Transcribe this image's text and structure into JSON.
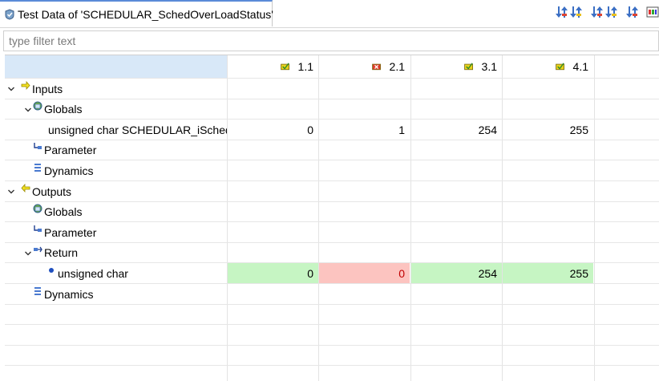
{
  "tab": {
    "title": "Test Data of 'SCHEDULAR_SchedOverLoadStatus'",
    "icon": "test-data-icon"
  },
  "toolbar": {
    "buttons": [
      {
        "icon": "move-down-up-icon"
      },
      {
        "icon": "move-down-up-icon"
      },
      {
        "icon": "move-down-up-icon"
      },
      {
        "icon": "move-down-up-icon"
      },
      {
        "icon": "move-down-up-icon"
      },
      {
        "icon": "view-menu-icon"
      }
    ]
  },
  "filter": {
    "placeholder": "type filter text",
    "value": ""
  },
  "columns": [
    {
      "label": "1.1",
      "status": "pass",
      "color": "#e8d21a"
    },
    {
      "label": "2.1",
      "status": "fail",
      "color": "#e03a2a"
    },
    {
      "label": "3.1",
      "status": "pass",
      "color": "#e8d21a"
    },
    {
      "label": "4.1",
      "status": "pass",
      "color": "#e8d21a"
    }
  ],
  "colors": {
    "pass_bg": "#c6f5c3",
    "fail_bg": "#fcc4c0",
    "fail_text": "#c00000",
    "header_bg": "#d8e8f8"
  },
  "rows": [
    {
      "label": "Inputs",
      "level": 0,
      "expanded": true,
      "icon": "inputs-arrow-icon",
      "values": [
        "",
        "",
        "",
        ""
      ]
    },
    {
      "label": "Globals",
      "level": 1,
      "expanded": true,
      "icon": "globals-icon",
      "values": [
        "",
        "",
        "",
        ""
      ]
    },
    {
      "label": "unsigned char SCHEDULAR_iSched",
      "level": 2,
      "expanded": null,
      "icon": "variable-dot-icon",
      "values": [
        "0",
        "1",
        "254",
        "255"
      ]
    },
    {
      "label": "Parameter",
      "level": 1,
      "expanded": null,
      "icon": "parameter-icon",
      "values": [
        "",
        "",
        "",
        ""
      ]
    },
    {
      "label": "Dynamics",
      "level": 1,
      "expanded": null,
      "icon": "dynamics-icon",
      "values": [
        "",
        "",
        "",
        ""
      ]
    },
    {
      "label": "Outputs",
      "level": 0,
      "expanded": true,
      "icon": "outputs-arrow-icon",
      "values": [
        "",
        "",
        "",
        ""
      ]
    },
    {
      "label": "Globals",
      "level": 1,
      "expanded": null,
      "icon": "globals-icon",
      "values": [
        "",
        "",
        "",
        ""
      ]
    },
    {
      "label": "Parameter",
      "level": 1,
      "expanded": null,
      "icon": "parameter-icon",
      "values": [
        "",
        "",
        "",
        ""
      ]
    },
    {
      "label": "Return",
      "level": 1,
      "expanded": true,
      "icon": "return-icon",
      "values": [
        "",
        "",
        "",
        ""
      ]
    },
    {
      "label": "unsigned char",
      "level": 2,
      "expanded": null,
      "icon": "variable-dot-icon",
      "values": [
        "0",
        "0",
        "254",
        "255"
      ],
      "results": [
        "pass",
        "fail",
        "pass",
        "pass"
      ]
    },
    {
      "label": "Dynamics",
      "level": 1,
      "expanded": null,
      "icon": "dynamics-icon",
      "values": [
        "",
        "",
        "",
        ""
      ]
    }
  ]
}
